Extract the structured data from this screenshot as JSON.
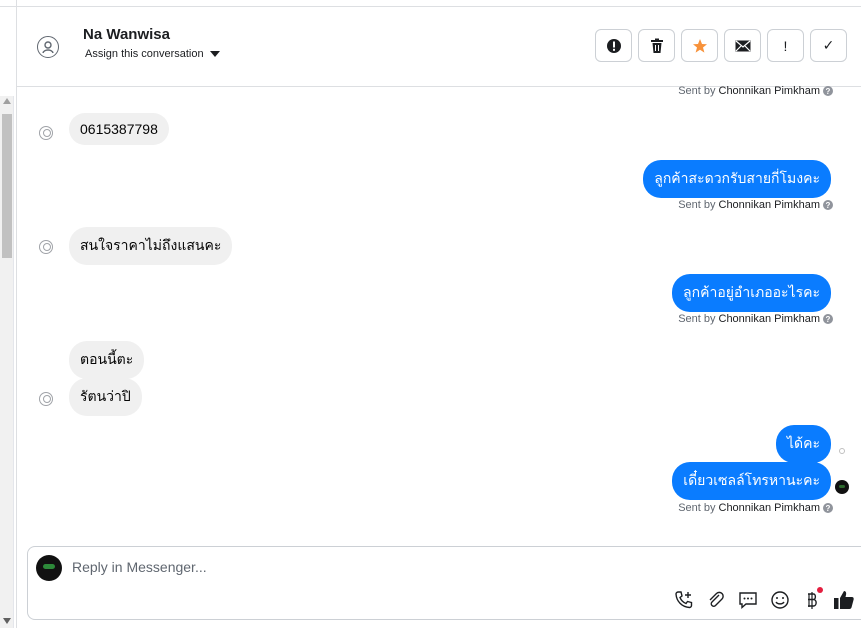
{
  "header": {
    "contact_name": "Na Wanwisa",
    "assign_label": "Assign this conversation"
  },
  "toolbar": [
    {
      "name": "spam-button",
      "icon": "alert-circle-icon"
    },
    {
      "name": "delete-button",
      "icon": "trash-icon"
    },
    {
      "name": "star-button",
      "icon": "star-icon",
      "color": "#f7923b"
    },
    {
      "name": "mark-unread-button",
      "icon": "envelope-icon"
    },
    {
      "name": "follow-up-button",
      "icon": "exclamation-icon",
      "glyph": "!"
    },
    {
      "name": "mark-done-button",
      "icon": "check-icon",
      "glyph": "✓"
    }
  ],
  "messages": [
    {
      "type": "sent_by_only",
      "prefix": "Sent by",
      "agent": "Chonnikan Pimkham"
    },
    {
      "type": "in",
      "text": "0615387798"
    },
    {
      "type": "out",
      "text": "ลูกค้าสะดวกรับสายกี่โมงคะ",
      "prefix": "Sent by",
      "agent": "Chonnikan Pimkham"
    },
    {
      "type": "in",
      "text": "สนใจราคาไม่ถึงแสนคะ"
    },
    {
      "type": "out",
      "text": "ลูกค้าอยู่อำเภออะไรคะ",
      "prefix": "Sent by",
      "agent": "Chonnikan Pimkham"
    },
    {
      "type": "in",
      "text": "ตอนนี้ตะ"
    },
    {
      "type": "in",
      "text": "รัตนว่าปิ"
    },
    {
      "type": "out",
      "text": "ได้คะ"
    },
    {
      "type": "out",
      "text": "เดี๋ยวเซลล์โทรหานะคะ",
      "prefix": "Sent by",
      "agent": "Chonnikan Pimkham"
    }
  ],
  "composer": {
    "placeholder": "Reply in Messenger...",
    "icons": [
      "phone-add-icon",
      "attach-icon",
      "saved-reply-icon",
      "emoji-icon",
      "baht-payment-icon",
      "thumbs-up-icon"
    ]
  },
  "colors": {
    "outgoing_bubble": "#0a7cff",
    "incoming_bubble": "#f0f0f0",
    "star": "#f7923b"
  }
}
